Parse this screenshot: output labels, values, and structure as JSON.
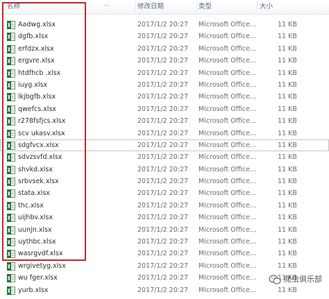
{
  "header": {
    "name_label": "名称",
    "date_label": "修改日期",
    "type_label": "类型",
    "size_label": "大小"
  },
  "files": [
    {
      "name": "Aadwg.xlsx",
      "date": "2017/1/2 20:27",
      "type": "Microsoft Office...",
      "size": "11 KB"
    },
    {
      "name": "dgfb.xlsx",
      "date": "2017/1/2 20:27",
      "type": "Microsoft Office...",
      "size": "11 KB"
    },
    {
      "name": "erfdzx.xlsx",
      "date": "2017/1/2 20:27",
      "type": "Microsoft Office...",
      "size": "11 KB"
    },
    {
      "name": "ergvre.xlsx",
      "date": "2017/1/2 20:27",
      "type": "Microsoft Office...",
      "size": "11 KB"
    },
    {
      "name": "htdfhcb .xlsx",
      "date": "2017/1/2 20:27",
      "type": "Microsoft Office...",
      "size": "11 KB"
    },
    {
      "name": "iuyg.xlsx",
      "date": "2017/1/2 20:27",
      "type": "Microsoft Office...",
      "size": "11 KB"
    },
    {
      "name": "lkjbgfb.xlsx",
      "date": "2017/1/2 20:27",
      "type": "Microsoft Office...",
      "size": "11 KB"
    },
    {
      "name": "qwefcs.xlsx",
      "date": "2017/1/2 20:27",
      "type": "Microsoft Office...",
      "size": "11 KB"
    },
    {
      "name": "r278fsfjcs.xlsx",
      "date": "2017/1/2 20:27",
      "type": "Microsoft Office...",
      "size": "11 KB"
    },
    {
      "name": "scv ukasv.xlsx",
      "date": "2017/1/2 20:27",
      "type": "Microsoft Office...",
      "size": "11 KB"
    },
    {
      "name": "sdgfvcx.xlsx",
      "date": "2017/1/2 20:27",
      "type": "Microsoft Office...",
      "size": "11 KB"
    },
    {
      "name": "sdvzsvfd.xlsx",
      "date": "2017/1/2 20:27",
      "type": "Microsoft Office...",
      "size": "11 KB"
    },
    {
      "name": "shvkd.xlsx",
      "date": "2017/1/2 20:27",
      "type": "Microsoft Office...",
      "size": "11 KB"
    },
    {
      "name": "srbvsek.xlsx",
      "date": "2017/1/2 20:27",
      "type": "Microsoft Office...",
      "size": "11 KB"
    },
    {
      "name": "stata.xlsx",
      "date": "2017/1/2 20:27",
      "type": "Microsoft Office...",
      "size": "11 KB"
    },
    {
      "name": "thc.xlsx",
      "date": "2017/1/2 20:27",
      "type": "Microsoft Office...",
      "size": "11 KB"
    },
    {
      "name": "uijhbv.xlsx",
      "date": "2017/1/2 20:27",
      "type": "Microsoft Office...",
      "size": "11 KB"
    },
    {
      "name": "uunjn.xlsx",
      "date": "2017/1/2 20:27",
      "type": "Microsoft Office...",
      "size": "11 KB"
    },
    {
      "name": "uythbc.xlsx",
      "date": "2017/1/2 20:27",
      "type": "Microsoft Office...",
      "size": "11 KB"
    },
    {
      "name": "wasrgvdf.xlsx",
      "date": "2017/1/2 20:27",
      "type": "Microsoft Office...",
      "size": "11 KB"
    },
    {
      "name": "wrgivetyg.xlsx",
      "date": "2017/1/2 20:27",
      "type": "Microsoft Office...",
      "size": "11 KB"
    },
    {
      "name": "wu  fger.xlsx",
      "date": "2017/1/2 20:27",
      "type": "Microsoft Office...",
      "size": "11 KB"
    },
    {
      "name": "yurb.xlsx",
      "date": "2017/1/2 20:27",
      "type": "Microsoft Office...",
      "size": "11 KB"
    }
  ],
  "hovered_row": 10,
  "file_icon": "excel-file-icon",
  "highlight_color": "#c0272d",
  "watermark": {
    "text": "爬虫俱乐部",
    "icon": "wechat-icon"
  }
}
